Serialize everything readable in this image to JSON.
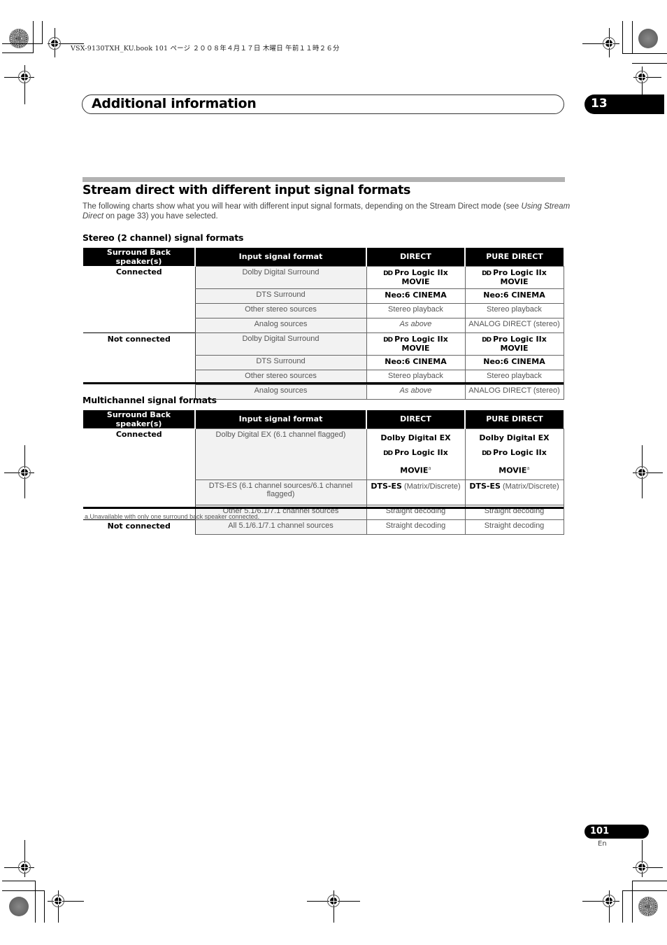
{
  "print_header": "VSX-9130TXH_KU.book  101 ページ  ２００８年４月１７日  木曜日  午前１１時２６分",
  "chapter": {
    "title": "Additional information",
    "number": "13"
  },
  "section": {
    "title": "Stream direct with different input signal formats",
    "intro_pre": "The following charts show what you will hear with different input signal formats, depending on the Stream Direct mode (see ",
    "intro_link": "Using Stream Direct",
    "intro_post": " on page 33) you have selected."
  },
  "stereo_table": {
    "title": "Stereo (2 channel) signal formats",
    "headers": [
      "Surround Back speaker(s)",
      "Input signal format",
      "DIRECT",
      "PURE DIRECT"
    ],
    "groups": [
      {
        "surround_back": "Connected",
        "rows": [
          {
            "input": "Dolby Digital Surround",
            "direct": "Pro Logic IIx MOVIE",
            "pure_direct": "Pro Logic IIx MOVIE",
            "style": "dolby"
          },
          {
            "input": "DTS Surround",
            "direct": "Neo:6 CINEMA",
            "pure_direct": "Neo:6 CINEMA",
            "style": "bold"
          },
          {
            "input": "Other stereo sources",
            "direct": "Stereo playback",
            "pure_direct": "Stereo playback",
            "style": "plain"
          },
          {
            "input": "Analog sources",
            "direct": "As above",
            "pure_direct": "ANALOG DIRECT (stereo)",
            "style": "analog"
          }
        ]
      },
      {
        "surround_back": "Not connected",
        "rows": [
          {
            "input": "Dolby Digital Surround",
            "direct": "Pro Logic IIx MOVIE",
            "pure_direct": "Pro Logic IIx MOVIE",
            "style": "dolby"
          },
          {
            "input": "DTS Surround",
            "direct": "Neo:6 CINEMA",
            "pure_direct": "Neo:6 CINEMA",
            "style": "bold"
          },
          {
            "input": "Other stereo sources",
            "direct": "Stereo playback",
            "pure_direct": "Stereo playback",
            "style": "plain"
          },
          {
            "input": "Analog sources",
            "direct": "As above",
            "pure_direct": "ANALOG DIRECT (stereo)",
            "style": "analog"
          }
        ]
      }
    ]
  },
  "multichannel_table": {
    "title": "Multichannel signal formats",
    "headers": [
      "Surround Back speaker(s)",
      "Input signal format",
      "DIRECT",
      "PURE DIRECT"
    ],
    "groups": [
      {
        "surround_back": "Connected",
        "rows": [
          {
            "input": "Dolby Digital EX (6.1 channel flagged)",
            "direct_line1": "Dolby Digital EX",
            "direct_line2": "Pro Logic IIx MOVIE",
            "pure_line1": "Dolby Digital EX",
            "pure_line2": "Pro Logic IIx MOVIE",
            "footnote_mark": "a"
          },
          {
            "input": "DTS-ES (6.1 channel sources/6.1 channel flagged)",
            "direct_bold": "DTS-ES",
            "direct_rest": " (Matrix/Discrete)",
            "pure_bold": "DTS-ES",
            "pure_rest": " (Matrix/Discrete)"
          },
          {
            "input": "Other 5.1/6.1/7.1 channel sources",
            "direct": "Straight decoding",
            "pure_direct": "Straight decoding"
          }
        ]
      },
      {
        "surround_back": "Not connected",
        "rows": [
          {
            "input": "All 5.1/6.1/7.1 channel sources",
            "direct": "Straight decoding",
            "pure_direct": "Straight decoding"
          }
        ]
      }
    ]
  },
  "footnote": "a.Unavailable with only one surround back speaker connected.",
  "dolby_symbol": "DD",
  "page": {
    "number": "101",
    "lang": "En"
  }
}
